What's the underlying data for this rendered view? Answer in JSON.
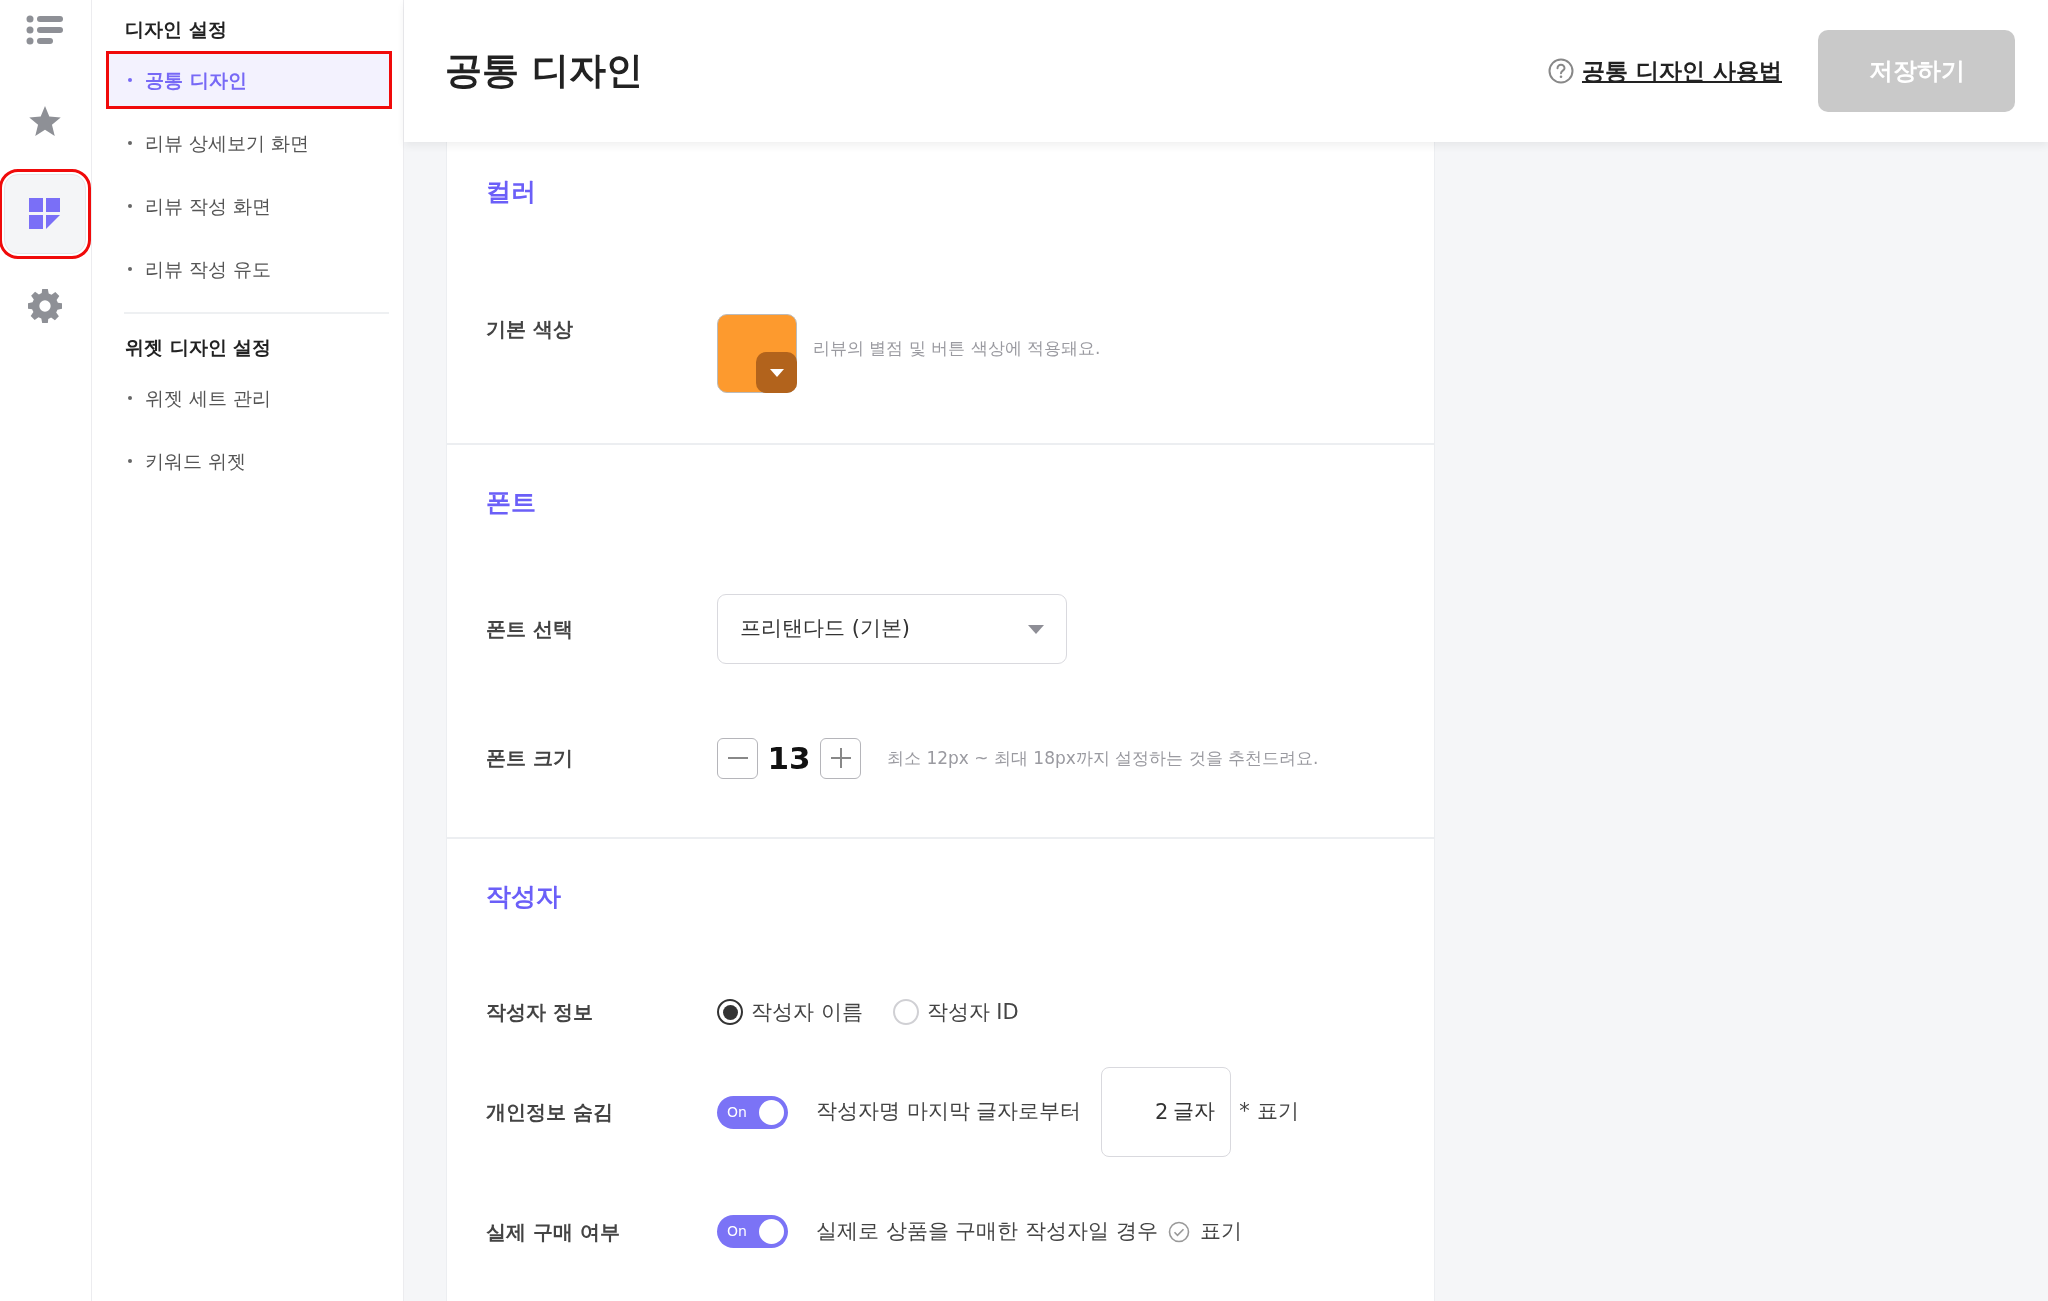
{
  "icon_rail": [
    {
      "kind": "list",
      "selected": false,
      "highlighted": false
    },
    {
      "kind": "star",
      "selected": false,
      "highlighted": false
    },
    {
      "kind": "grid",
      "selected": true,
      "highlighted": true
    },
    {
      "kind": "gear",
      "selected": false,
      "highlighted": false
    }
  ],
  "sidebar": {
    "groups": [
      {
        "title": "디자인 설정",
        "items": [
          {
            "label": "공통 디자인",
            "selected": true,
            "highlighted": true
          },
          {
            "label": "리뷰 상세보기 화면",
            "selected": false,
            "highlighted": false
          },
          {
            "label": "리뷰 작성 화면",
            "selected": false,
            "highlighted": false
          },
          {
            "label": "리뷰 작성 유도",
            "selected": false,
            "highlighted": false
          }
        ]
      },
      {
        "title": "위젯 디자인 설정",
        "items": [
          {
            "label": "위젯 세트 관리",
            "selected": false,
            "highlighted": false
          },
          {
            "label": "키워드 위젯",
            "selected": false,
            "highlighted": false
          }
        ]
      }
    ]
  },
  "header": {
    "title": "공통 디자인",
    "help_link": "공통 디자인 사용법",
    "save_button": {
      "label": "저장하기",
      "disabled": true
    }
  },
  "sections": [
    {
      "title": "컬러",
      "rows": [
        {
          "kind": "color",
          "label": "기본 색상",
          "color": "#fd9a2e",
          "hint": "리뷰의 별점 및 버튼 색상에 적용돼요."
        }
      ]
    },
    {
      "title": "폰트",
      "rows": [
        {
          "kind": "select",
          "label": "폰트 선택",
          "value": "프리탠다드 (기본)"
        },
        {
          "kind": "stepper",
          "label": "폰트 크기",
          "value": "13",
          "hint": "최소 12px ~ 최대 18px까지 설정하는 것을 추천드려요."
        }
      ]
    },
    {
      "title": "작성자",
      "rows": [
        {
          "kind": "radio",
          "label": "작성자 정보",
          "options": [
            {
              "label": "작성자 이름",
              "selected": true
            },
            {
              "label": "작성자 ID",
              "selected": false
            }
          ]
        },
        {
          "kind": "toggle_input",
          "label": "개인정보 숨김",
          "on": true,
          "toggle_label": "On",
          "text": "작성자명 마지막 글자로부터",
          "input_value": "2",
          "unit": "글자",
          "suffix": "* 표기"
        },
        {
          "kind": "toggle_check",
          "label": "실제 구매 여부",
          "on": true,
          "toggle_label": "On",
          "text": "실제로 상품을 구매한 작성자일 경우",
          "suffix": "표기"
        }
      ]
    }
  ]
}
